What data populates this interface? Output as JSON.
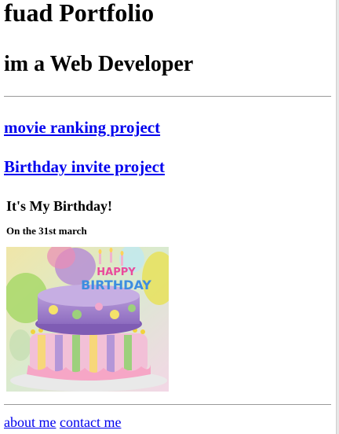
{
  "header": {
    "title": "fuad Portfolio",
    "subtitle": "im a Web Developer"
  },
  "projects": [
    {
      "label": "movie ranking project"
    },
    {
      "label": "Birthday invite project"
    }
  ],
  "invite": {
    "title": "It's My Birthday!",
    "date": "On the 31st march",
    "cake_text": "HAPPY BIRTHDAY"
  },
  "footer": {
    "links": [
      {
        "label": "about me"
      },
      {
        "label": "contact me"
      }
    ]
  }
}
